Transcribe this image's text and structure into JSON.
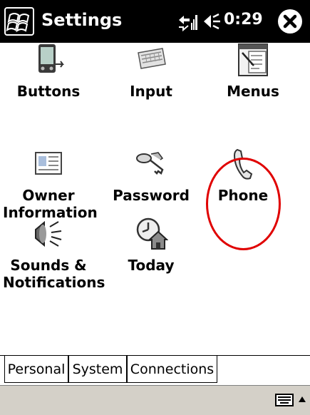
{
  "titlebar": {
    "title": "Settings",
    "time": "0:29"
  },
  "icons": [
    "windows-start-icon",
    "connectivity-icon",
    "speaker-icon",
    "close-icon",
    "keyboard-icon",
    "up-arrow-icon"
  ],
  "items": [
    {
      "label": "Buttons"
    },
    {
      "label": "Input"
    },
    {
      "label": "Menus"
    },
    {
      "label": "Owner Information"
    },
    {
      "label": "Password"
    },
    {
      "label": "Phone"
    },
    {
      "label": "Sounds & Notifications"
    },
    {
      "label": "Today"
    }
  ],
  "tabs": [
    {
      "label": "Personal",
      "active": true
    },
    {
      "label": "System",
      "active": false
    },
    {
      "label": "Connections",
      "active": false
    }
  ],
  "colors": {
    "titlebar": "#000000",
    "highlight": "#e00000",
    "bottombar": "#d4d0c8"
  }
}
